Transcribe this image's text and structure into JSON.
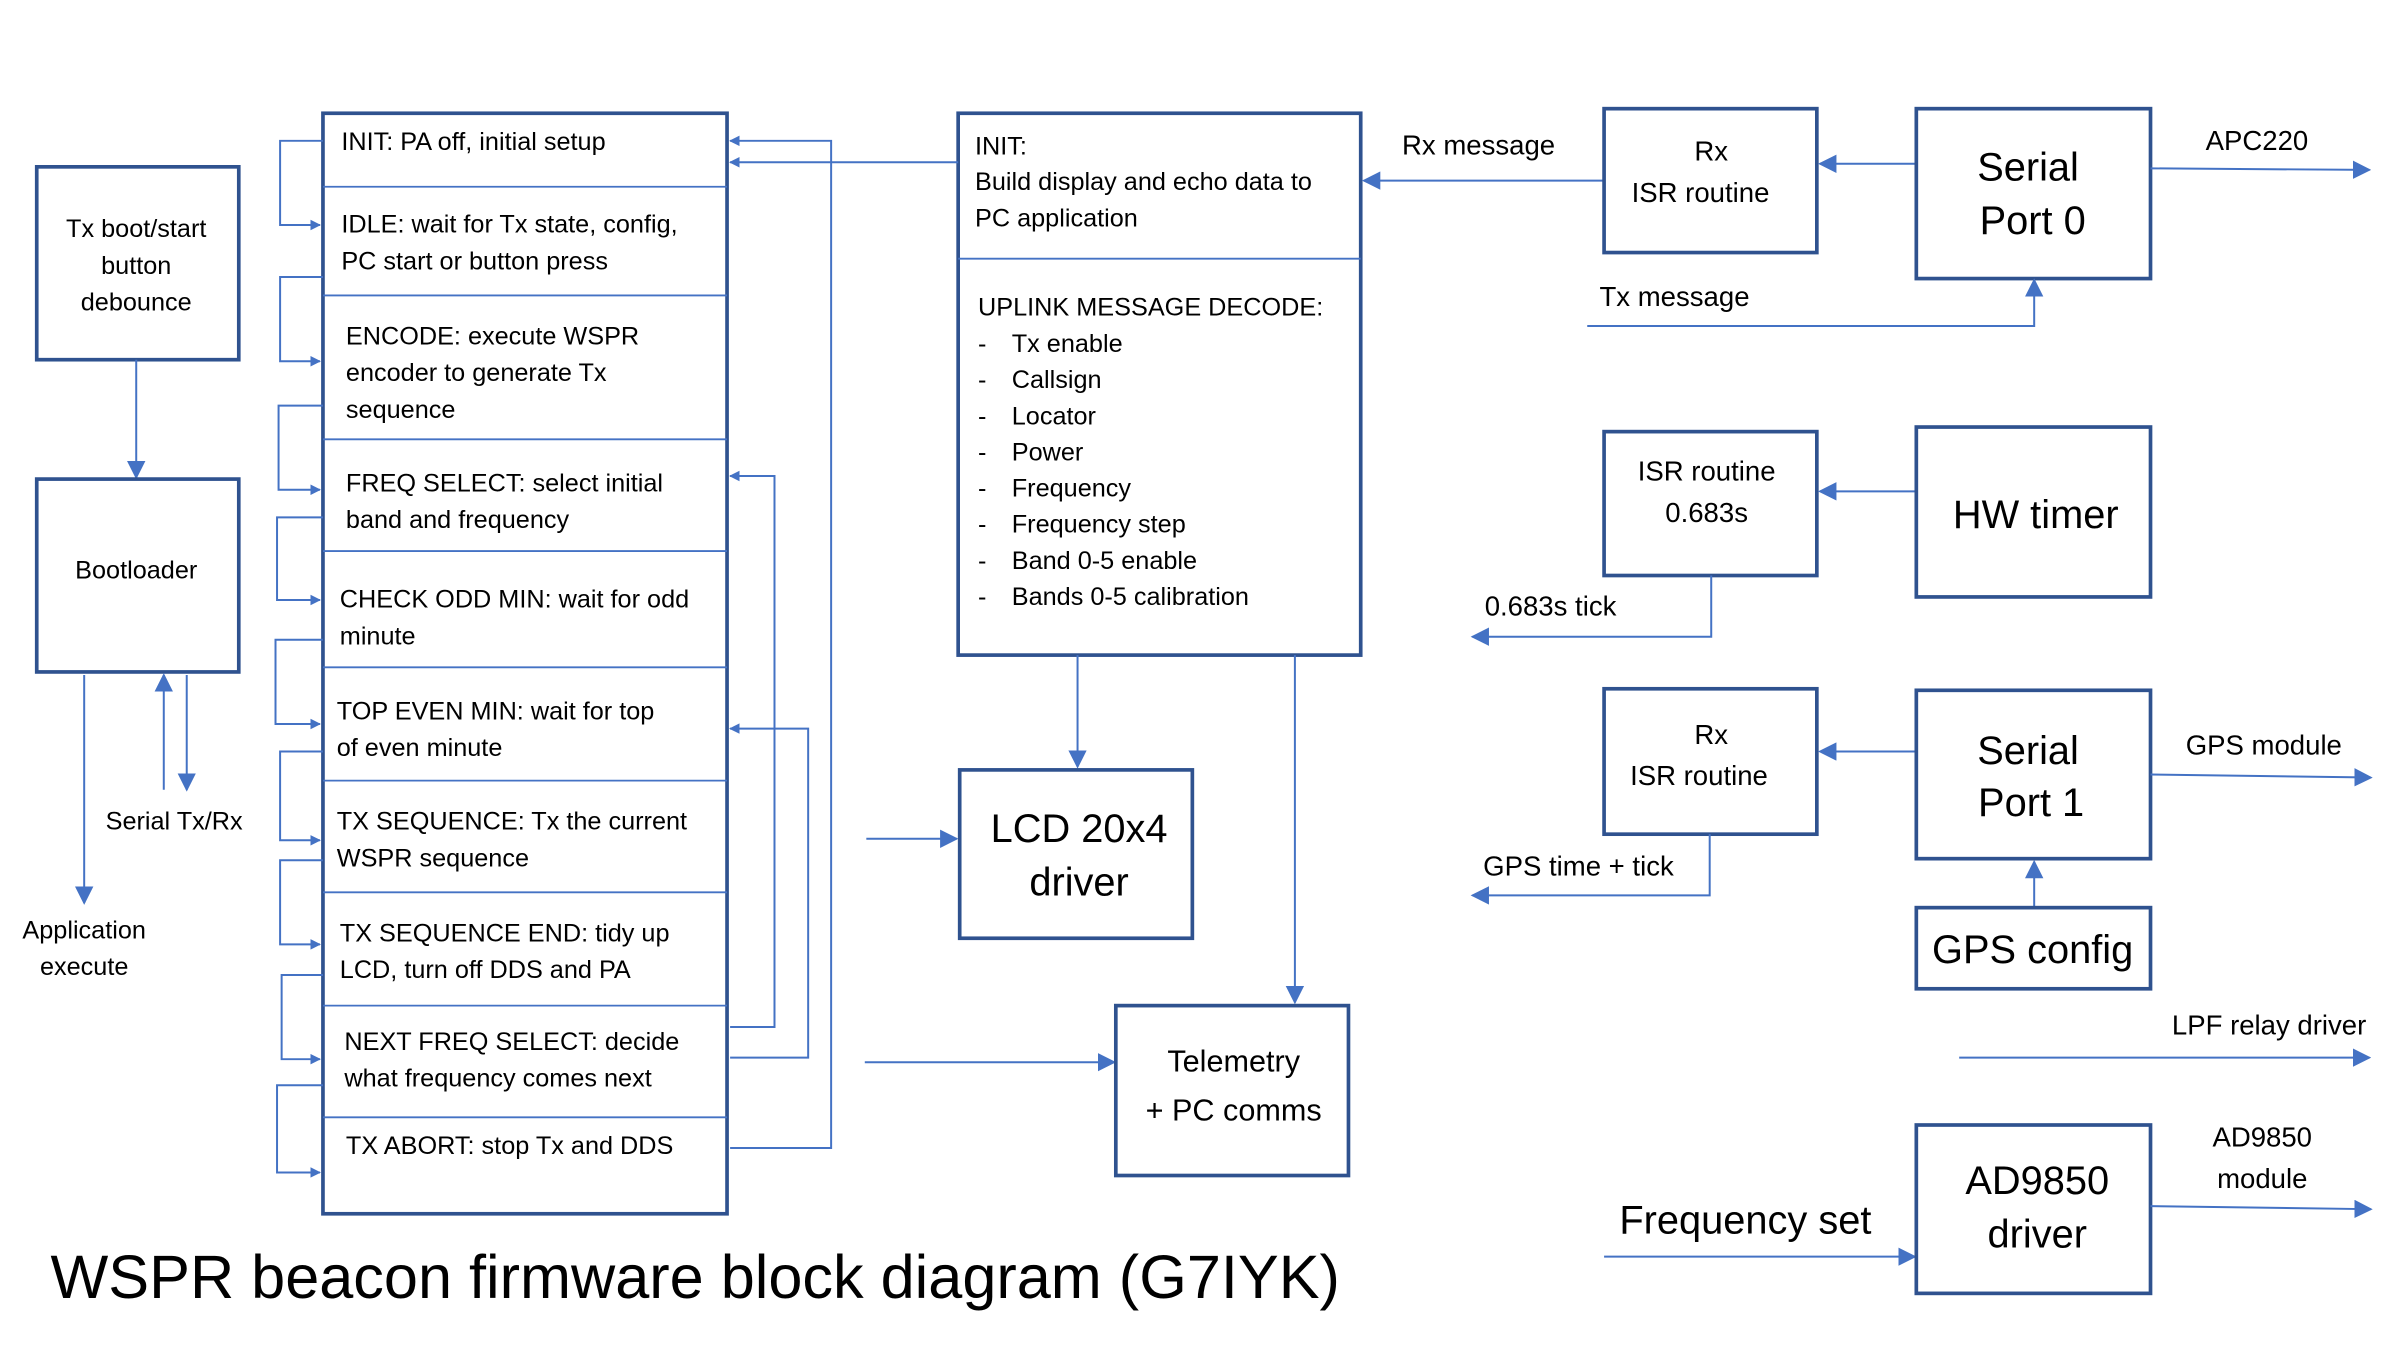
{
  "title": "WSPR beacon firmware block diagram (G7IYK)",
  "colors": {
    "box_border": "#2F528F",
    "connector": "#4472C4",
    "text": "#000000",
    "background": "#FFFFFF"
  },
  "boot": {
    "tx_boot": [
      "Tx boot/start",
      "button",
      "debounce"
    ],
    "bootloader": "Bootloader",
    "serial_label": "Serial Tx/Rx",
    "app_execute": [
      "Application",
      "execute"
    ]
  },
  "states": [
    {
      "lines": [
        "INIT: PA off, initial setup"
      ]
    },
    {
      "lines": [
        "IDLE: wait for Tx state, config,",
        "PC start or button press"
      ]
    },
    {
      "lines": [
        "ENCODE: execute WSPR",
        "encoder to generate Tx",
        "sequence"
      ]
    },
    {
      "lines": [
        "FREQ SELECT: select initial",
        "band and frequency"
      ]
    },
    {
      "lines": [
        "CHECK ODD MIN: wait for odd",
        "minute"
      ]
    },
    {
      "lines": [
        "TOP EVEN MIN: wait for top",
        "of even minute"
      ]
    },
    {
      "lines": [
        "TX SEQUENCE: Tx the current",
        "WSPR sequence"
      ]
    },
    {
      "lines": [
        "TX SEQUENCE END: tidy up",
        "LCD, turn off DDS and PA"
      ]
    },
    {
      "lines": [
        "NEXT FREQ SELECT: decide",
        "what frequency comes next"
      ]
    },
    {
      "lines": [
        "TX ABORT: stop Tx and DDS"
      ]
    }
  ],
  "uplink": {
    "init_lines": [
      "INIT:",
      "Build display and echo data to",
      "PC application"
    ],
    "decode_title": "UPLINK MESSAGE DECODE:",
    "bullet": "-",
    "items": [
      "Tx enable",
      "Callsign",
      "Locator",
      "Power",
      "Frequency",
      "Frequency step",
      "Band 0-5 enable",
      "Bands 0-5 calibration"
    ]
  },
  "lcd": [
    "LCD 20x4",
    "driver"
  ],
  "telemetry": [
    "Telemetry",
    "+ PC comms"
  ],
  "serial0": {
    "rx_message": "Rx message",
    "tx_message": "Tx message",
    "isr": [
      "Rx",
      "ISR routine"
    ],
    "port": [
      "Serial",
      "Port 0"
    ],
    "output": "APC220"
  },
  "timer": {
    "isr": [
      "ISR routine",
      "0.683s"
    ],
    "hw": "HW timer",
    "tick": "0.683s tick"
  },
  "serial1": {
    "isr": [
      "Rx",
      "ISR routine"
    ],
    "port": [
      "Serial",
      "Port 1"
    ],
    "output": "GPS module",
    "tick": "GPS time + tick",
    "config": "GPS config"
  },
  "lpf": "LPF relay driver",
  "dds": {
    "input": "Frequency set",
    "driver": [
      "AD9850",
      "driver"
    ],
    "output": [
      "AD9850",
      "module"
    ]
  }
}
